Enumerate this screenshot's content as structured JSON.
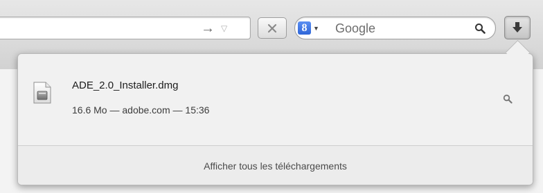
{
  "toolbar": {
    "go_glyph": "→",
    "history_glyph": "▽",
    "search": {
      "engine_letter": "8",
      "engine_caret": "▼",
      "placeholder": "Google",
      "engine_color": "#3b74e3"
    }
  },
  "downloads": {
    "items": [
      {
        "file_name": "ADE_2.0_Installer.dmg",
        "status": "16.6 Mo — adobe.com — 15:36",
        "icon": "dmg-file-icon"
      }
    ],
    "show_all_label": "Afficher tous les téléchargements"
  }
}
